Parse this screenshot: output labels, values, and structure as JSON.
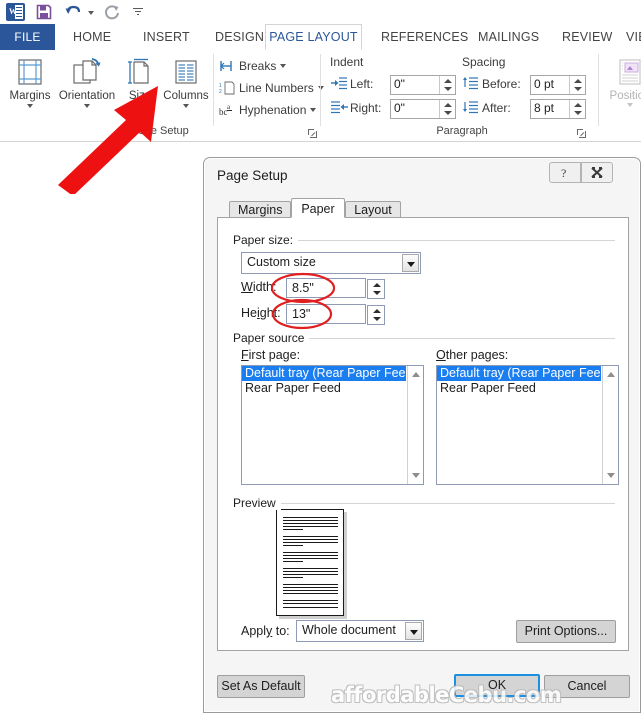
{
  "app": {
    "quick_access": [
      {
        "name": "word-logo-icon",
        "label": "W"
      },
      {
        "name": "save-icon",
        "label": "Save"
      },
      {
        "name": "undo-icon",
        "label": "Undo"
      },
      {
        "name": "redo-icon",
        "label": "Redo"
      },
      {
        "name": "customize-quick-access-icon",
        "label": "Customize Quick Access Toolbar"
      }
    ],
    "tabs": [
      {
        "label": "FILE",
        "active": false,
        "file": true
      },
      {
        "label": "HOME",
        "active": false
      },
      {
        "label": "INSERT",
        "active": false
      },
      {
        "label": "DESIGN",
        "active": false
      },
      {
        "label": "PAGE LAYOUT",
        "active": true
      },
      {
        "label": "REFERENCES",
        "active": false
      },
      {
        "label": "MAILINGS",
        "active": false
      },
      {
        "label": "REVIEW",
        "active": false
      },
      {
        "label": "VIEW",
        "active": false
      }
    ]
  },
  "ribbon": {
    "page_setup": {
      "group_label": "Page Setup",
      "buttons": [
        {
          "label": "Margins",
          "icon": "margins-icon"
        },
        {
          "label": "Orientation",
          "icon": "orientation-icon"
        },
        {
          "label": "Size",
          "icon": "size-icon"
        },
        {
          "label": "Columns",
          "icon": "columns-icon"
        }
      ],
      "small_buttons": [
        {
          "label": "Breaks",
          "icon": "breaks-icon"
        },
        {
          "label": "Line Numbers",
          "icon": "line-numbers-icon"
        },
        {
          "label": "Hyphenation",
          "icon": "hyphenation-icon"
        }
      ]
    },
    "paragraph": {
      "group_label": "Paragraph",
      "indent_label": "Indent",
      "spacing_label": "Spacing",
      "fields": [
        {
          "label": "Left:",
          "value": "0\"",
          "name": "indent-left"
        },
        {
          "label": "Right:",
          "value": "0\"",
          "name": "indent-right"
        },
        {
          "label": "Before:",
          "value": "0 pt",
          "name": "spacing-before"
        },
        {
          "label": "After:",
          "value": "8 pt",
          "name": "spacing-after"
        }
      ]
    },
    "arrange": {
      "position_label": "Position"
    }
  },
  "dialog": {
    "title": "Page Setup",
    "help_label": "?",
    "close_label": "✕",
    "tabs": [
      {
        "label": "Margins",
        "active": false
      },
      {
        "label": "Paper",
        "active": true
      },
      {
        "label": "Layout",
        "active": false
      }
    ],
    "paper_size": {
      "group_label": "Paper size:",
      "selected": "Custom size",
      "width_label": "Width:",
      "width_value": "8.5\"",
      "height_label": "Height:",
      "height_value": "13\""
    },
    "paper_source": {
      "group_label": "Paper source",
      "first_page_label": "First page:",
      "other_pages_label": "Other pages:",
      "first_page_items": [
        "Default tray (Rear Paper Feed)",
        "Rear Paper Feed"
      ],
      "first_page_selected_index": 0,
      "other_pages_items": [
        "Default tray (Rear Paper Feed)",
        "Rear Paper Feed"
      ],
      "other_pages_selected_index": 0
    },
    "preview": {
      "group_label": "Preview"
    },
    "apply_to": {
      "label": "Apply to:",
      "value": "Whole document"
    },
    "buttons": {
      "print_options": "Print Options...",
      "set_as_default": "Set As Default",
      "ok": "OK",
      "cancel": "Cancel"
    }
  },
  "watermark": {
    "text": "affordableCebu.com"
  },
  "annotations": {
    "arrow_color": "#ee1111",
    "circle_color": "#e02020",
    "accent_color": "#2b579a",
    "highlight_color": "#1a7ef0"
  }
}
